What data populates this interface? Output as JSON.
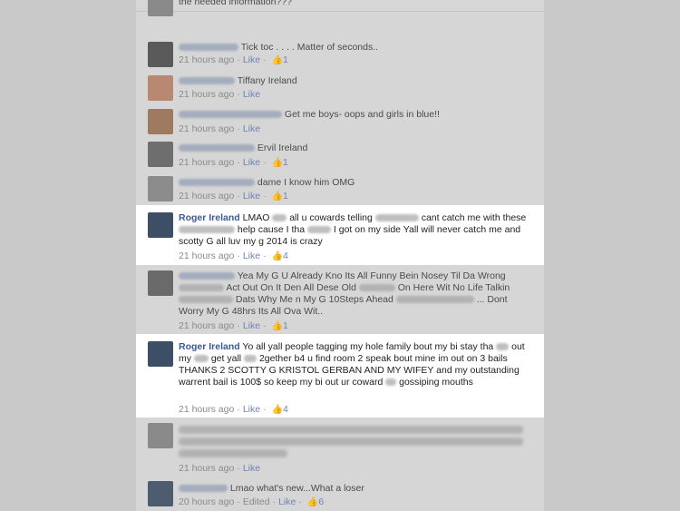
{
  "comments": [
    {
      "text": "the needed information???",
      "meta": {
        "time": "",
        "like": "",
        "count": ""
      }
    },
    {
      "text": "Tick toc . . . . Matter of seconds..",
      "meta": {
        "time": "21 hours ago",
        "like": "Like",
        "count": "1"
      }
    },
    {
      "text": "Tiffany Ireland",
      "meta": {
        "time": "21 hours ago",
        "like": "Like",
        "count": ""
      }
    },
    {
      "text": "Get me boys- oops and girls in blue!!",
      "meta": {
        "time": "21 hours ago",
        "like": "Like",
        "count": ""
      }
    },
    {
      "text": "Ervil Ireland",
      "meta": {
        "time": "21 hours ago",
        "like": "Like",
        "count": "1"
      }
    },
    {
      "text": "dame I know him OMG",
      "meta": {
        "time": "21 hours ago",
        "like": "Like",
        "count": "1"
      }
    },
    {
      "name": "Roger Ireland",
      "parts": [
        "LMAO",
        "all u cowards telling",
        "cant catch me with these",
        "help cause I tha",
        "I got on my side Yall will never catch me and scotty G all luv my g 2014 is crazy"
      ],
      "meta": {
        "time": "21 hours ago",
        "like": "Like",
        "count": "4"
      }
    },
    {
      "parts": [
        "Yea My G U Already Kno Its All Funny Bein Nosey Til Da Wrong",
        "Act Out On It Den All Dese Old",
        "On Here Wit No Life Talkin",
        "Dats Why Me n My G 10Steps Ahead",
        "... Dont Worry My G 48hrs Its All Ova Wit.."
      ],
      "meta": {
        "time": "21 hours ago",
        "like": "Like",
        "count": "1"
      }
    },
    {
      "name": "Roger Ireland",
      "parts": [
        "Yo all yall people tagging my hole family bout my bi stay tha",
        "out my",
        "get yall",
        "2gether b4 u find room 2 speak bout mine im out on 3 bails THANKS 2 SCOTTY G KRISTOL GERBAN AND MY WIFEY and my outstanding warrent bail is 100$ so keep my bi out ur coward",
        "gossiping mouths"
      ],
      "meta": {
        "time": "21 hours ago",
        "like": "Like",
        "count": "4"
      }
    },
    {
      "meta": {
        "time": "21 hours ago",
        "like": "Like",
        "count": ""
      }
    },
    {
      "text": "Lmao what's new...What a loser",
      "meta": {
        "time": "20 hours ago",
        "edited": "Edited",
        "like": "Like",
        "count": "6"
      }
    }
  ],
  "icons": {
    "like": "thumbs-up-icon"
  },
  "colors": {
    "name": "#3b5998",
    "highlight": "#ffffff",
    "background": "#c9c9c9"
  }
}
